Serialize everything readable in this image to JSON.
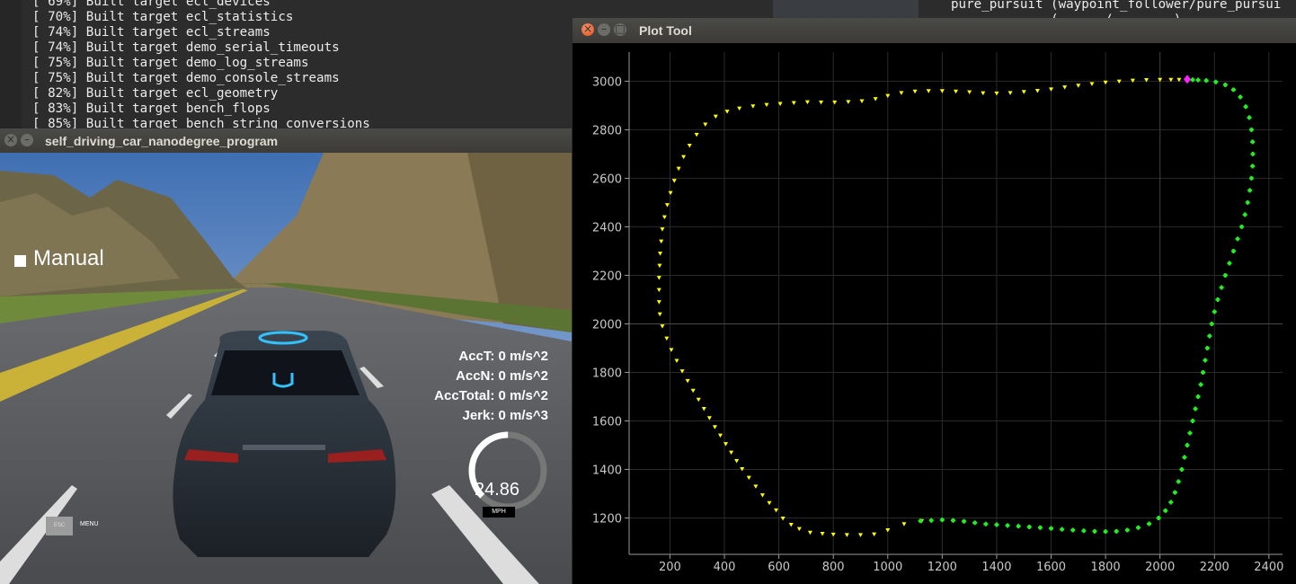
{
  "terminal": {
    "lines": [
      "[ 69%] Built target ecl_devices",
      "[ 70%] Built target ecl_statistics",
      "[ 74%] Built target ecl_streams",
      "[ 74%] Built target demo_serial_timeouts",
      "[ 75%] Built target demo_log_streams",
      "[ 75%] Built target demo_console_streams",
      "[ 82%] Built target ecl_geometry",
      "[ 83%] Built target bench_flops",
      "[ 85%] Built target bench_string_conversions"
    ],
    "right_lines": [
      "pure_pursuit (waypoint_follower/pure_pursui",
      "     ...     (...   /...     )"
    ]
  },
  "simulator": {
    "title": "self_driving_car_nanodegree_program",
    "mode_label": "Manual",
    "acc_t": "AccT: 0 m/s^2",
    "acc_n": "AccN: 0 m/s^2",
    "acc_total": "AccTotal: 0 m/s^2",
    "jerk": "Jerk: 0 m/s^3",
    "speed": "24.86",
    "speed_unit": "MPH",
    "esc_label": "ESC",
    "menu_label": "MENU",
    "gauge_fraction": 0.5
  },
  "plot_tool": {
    "title": "Plot Tool"
  },
  "colors": {
    "planned": "#ffff00",
    "actual": "#22ee22",
    "current": "#ff22ff",
    "close_button": "#e1501e",
    "terminal_bg": "#2c2c2c"
  },
  "chart_data": {
    "type": "scatter",
    "xlim": [
      50,
      2450
    ],
    "ylim": [
      1050,
      3120
    ],
    "x_ticks": [
      200,
      400,
      600,
      800,
      1000,
      1200,
      1400,
      1600,
      1800,
      2000,
      2200,
      2400
    ],
    "y_ticks": [
      1200,
      1400,
      1600,
      1800,
      2000,
      2200,
      2400,
      2600,
      2800,
      3000
    ],
    "grid": true,
    "series": [
      {
        "marker": "triangle-down",
        "color": "#ffff00",
        "points": [
          [
            1125,
            1188
          ],
          [
            1060,
            1175
          ],
          [
            1000,
            1150
          ],
          [
            950,
            1133
          ],
          [
            900,
            1130
          ],
          [
            850,
            1130
          ],
          [
            800,
            1132
          ],
          [
            760,
            1135
          ],
          [
            715,
            1140
          ],
          [
            675,
            1155
          ],
          [
            645,
            1172
          ],
          [
            615,
            1198
          ],
          [
            590,
            1232
          ],
          [
            565,
            1262
          ],
          [
            540,
            1294
          ],
          [
            515,
            1330
          ],
          [
            490,
            1366
          ],
          [
            465,
            1402
          ],
          [
            445,
            1435
          ],
          [
            425,
            1470
          ],
          [
            405,
            1505
          ],
          [
            385,
            1540
          ],
          [
            365,
            1575
          ],
          [
            345,
            1612
          ],
          [
            325,
            1650
          ],
          [
            305,
            1688
          ],
          [
            285,
            1725
          ],
          [
            265,
            1765
          ],
          [
            245,
            1805
          ],
          [
            225,
            1848
          ],
          [
            205,
            1893
          ],
          [
            188,
            1940
          ],
          [
            172,
            1990
          ],
          [
            163,
            2040
          ],
          [
            160,
            2090
          ],
          [
            160,
            2140
          ],
          [
            160,
            2190
          ],
          [
            162,
            2240
          ],
          [
            164,
            2290
          ],
          [
            168,
            2340
          ],
          [
            172,
            2390
          ],
          [
            180,
            2440
          ],
          [
            190,
            2490
          ],
          [
            202,
            2540
          ],
          [
            216,
            2590
          ],
          [
            232,
            2640
          ],
          [
            250,
            2688
          ],
          [
            272,
            2735
          ],
          [
            298,
            2780
          ],
          [
            330,
            2822
          ],
          [
            368,
            2855
          ],
          [
            410,
            2875
          ],
          [
            455,
            2888
          ],
          [
            505,
            2897
          ],
          [
            555,
            2903
          ],
          [
            605,
            2907
          ],
          [
            655,
            2911
          ],
          [
            705,
            2914
          ],
          [
            755,
            2913
          ],
          [
            805,
            2913
          ],
          [
            855,
            2915
          ],
          [
            905,
            2918
          ],
          [
            955,
            2927
          ],
          [
            1000,
            2940
          ],
          [
            1050,
            2952
          ],
          [
            1100,
            2958
          ],
          [
            1150,
            2960
          ],
          [
            1200,
            2960
          ],
          [
            1250,
            2958
          ],
          [
            1300,
            2955
          ],
          [
            1350,
            2951
          ],
          [
            1400,
            2950
          ],
          [
            1450,
            2952
          ],
          [
            1500,
            2956
          ],
          [
            1550,
            2961
          ],
          [
            1600,
            2967
          ],
          [
            1650,
            2975
          ],
          [
            1700,
            2982
          ],
          [
            1750,
            2989
          ],
          [
            1800,
            2995
          ],
          [
            1850,
            2999
          ],
          [
            1900,
            3003
          ],
          [
            1950,
            3005
          ],
          [
            2000,
            3006
          ],
          [
            2040,
            3006
          ],
          [
            2070,
            3006
          ]
        ]
      },
      {
        "marker": "cross",
        "color": "#22ee22",
        "points": [
          [
            1120,
            1188
          ],
          [
            1160,
            1190
          ],
          [
            1200,
            1192
          ],
          [
            1240,
            1190
          ],
          [
            1280,
            1186
          ],
          [
            1320,
            1180
          ],
          [
            1360,
            1175
          ],
          [
            1400,
            1172
          ],
          [
            1440,
            1169
          ],
          [
            1480,
            1166
          ],
          [
            1520,
            1163
          ],
          [
            1560,
            1160
          ],
          [
            1600,
            1157
          ],
          [
            1640,
            1153
          ],
          [
            1680,
            1150
          ],
          [
            1720,
            1147
          ],
          [
            1760,
            1145
          ],
          [
            1800,
            1144
          ],
          [
            1840,
            1145
          ],
          [
            1880,
            1150
          ],
          [
            1920,
            1160
          ],
          [
            1960,
            1176
          ],
          [
            1995,
            1200
          ],
          [
            2020,
            1230
          ],
          [
            2040,
            1265
          ],
          [
            2055,
            1305
          ],
          [
            2068,
            1350
          ],
          [
            2080,
            1400
          ],
          [
            2090,
            1450
          ],
          [
            2100,
            1500
          ],
          [
            2110,
            1550
          ],
          [
            2120,
            1600
          ],
          [
            2130,
            1650
          ],
          [
            2140,
            1700
          ],
          [
            2150,
            1750
          ],
          [
            2158,
            1800
          ],
          [
            2166,
            1850
          ],
          [
            2174,
            1900
          ],
          [
            2182,
            1950
          ],
          [
            2190,
            2000
          ],
          [
            2200,
            2050
          ],
          [
            2212,
            2100
          ],
          [
            2226,
            2150
          ],
          [
            2240,
            2200
          ],
          [
            2255,
            2250
          ],
          [
            2270,
            2300
          ],
          [
            2285,
            2350
          ],
          [
            2300,
            2400
          ],
          [
            2312,
            2450
          ],
          [
            2322,
            2500
          ],
          [
            2330,
            2550
          ],
          [
            2336,
            2600
          ],
          [
            2340,
            2650
          ],
          [
            2341,
            2700
          ],
          [
            2340,
            2750
          ],
          [
            2336,
            2800
          ],
          [
            2328,
            2850
          ],
          [
            2315,
            2895
          ],
          [
            2295,
            2935
          ],
          [
            2270,
            2965
          ],
          [
            2240,
            2985
          ],
          [
            2205,
            2997
          ],
          [
            2170,
            3003
          ],
          [
            2140,
            3005
          ],
          [
            2120,
            3006
          ]
        ]
      },
      {
        "marker": "diamond",
        "color": "#ff22ff",
        "points": [
          [
            2100,
            3008
          ]
        ]
      }
    ]
  }
}
